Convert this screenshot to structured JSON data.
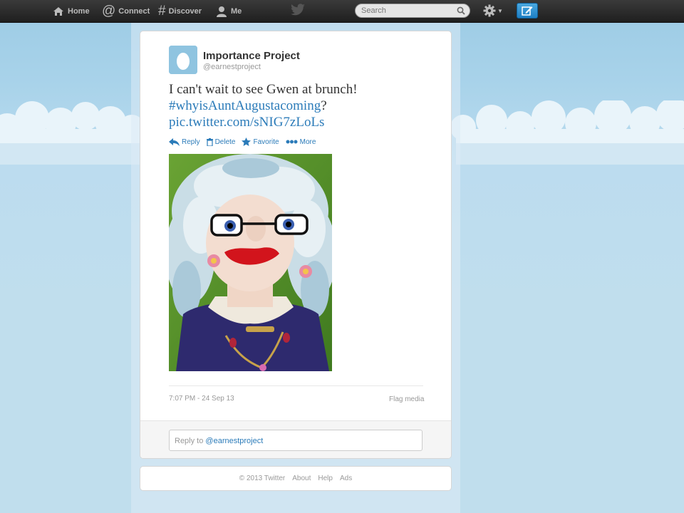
{
  "nav": {
    "home": "Home",
    "connect": "Connect",
    "discover": "Discover",
    "me": "Me"
  },
  "search": {
    "placeholder": "Search"
  },
  "tweet": {
    "author_name": "Importance Project",
    "author_handle": "@earnestproject",
    "text_before": "I can't wait to see Gwen at brunch!",
    "hashtag": "#whyisAuntAugustacoming",
    "text_after": "?",
    "media_link": "pic.twitter.com/sNIG7zLoLs",
    "actions": {
      "reply": "Reply",
      "delete": "Delete",
      "favorite": "Favorite",
      "more": "More"
    },
    "timestamp": "7:07 PM - 24 Sep 13",
    "flag_media": "Flag media"
  },
  "reply": {
    "prefix": "Reply to",
    "mention": "@earnestproject"
  },
  "footer": {
    "copyright": "© 2013 Twitter",
    "about": "About",
    "help": "Help",
    "ads": "Ads"
  },
  "colors": {
    "link": "#2b7bb9",
    "topbar": "#2b2b2b",
    "background": "#c0deed",
    "compose": "#2a8fd4"
  },
  "icons": [
    "home-icon",
    "at-icon",
    "hash-icon",
    "person-icon",
    "twitter-bird-icon",
    "search-icon",
    "gear-icon",
    "compose-icon",
    "reply-icon",
    "trash-icon",
    "star-icon",
    "more-icon",
    "egg-avatar-icon"
  ]
}
